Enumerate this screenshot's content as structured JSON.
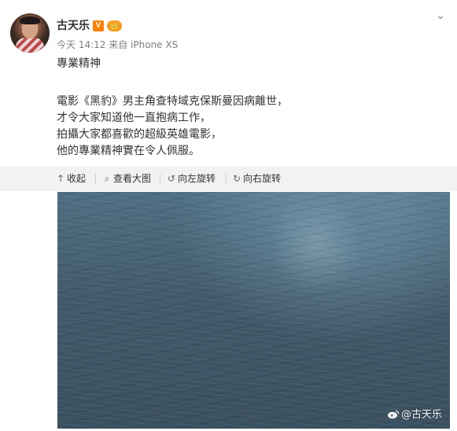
{
  "post": {
    "author": "古天乐",
    "verified_badge": "V",
    "vip_badge": "👑",
    "meta": "今天 14:12 来自 iPhone XS",
    "title": "專業精神",
    "content_lines": [
      "電影《黑豹》男主角查特域克保斯曼因病離世，",
      "才令大家知道他一直抱病工作，",
      "拍攝大家都喜歡的超級英雄電影，",
      "他的專業精神實在令人佩服。"
    ]
  },
  "toolbar": {
    "collapse": "收起",
    "view_large": "查看大图",
    "rotate_left": "向左旋转",
    "rotate_right": "向右旋转"
  },
  "image": {
    "watermark": "@古天乐",
    "scene": "sea-water-photo"
  },
  "colors": {
    "accent_orange": "#ff7f00",
    "toolbar_bg": "#f2f2f2",
    "text_main": "#333333",
    "text_meta": "#808080"
  }
}
